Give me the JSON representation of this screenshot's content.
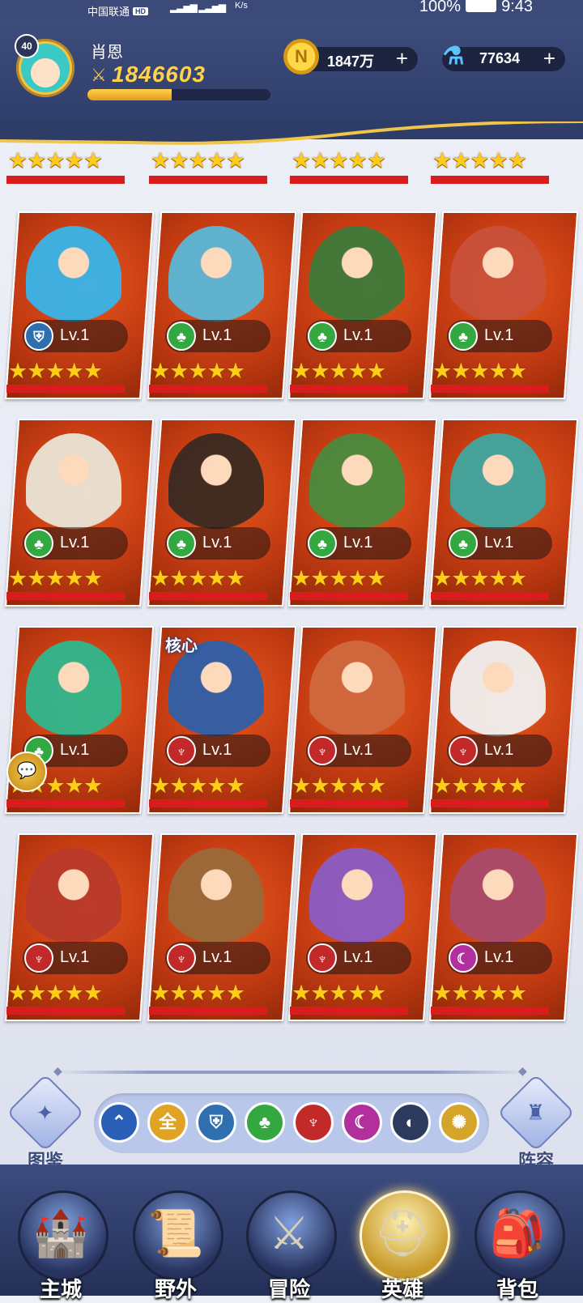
{
  "status_bar": {
    "carrier": "中国联通",
    "hd": "HD",
    "speed": "K/s",
    "battery": "100%",
    "time": "9:43"
  },
  "player": {
    "level": "40",
    "name": "肖恩",
    "power": "1846603",
    "exp_fraction": 0.46
  },
  "resources": {
    "gold": {
      "value": "1847万",
      "icon": "gold-coin-icon",
      "plus": "+"
    },
    "potion": {
      "value": "77634",
      "icon": "potion-icon",
      "plus": "+"
    }
  },
  "heroes": [
    {
      "level": "Lv.1",
      "faction": "fortress",
      "stars": 5,
      "art": "#39b4e8",
      "core": ""
    },
    {
      "level": "Lv.1",
      "faction": "forest",
      "stars": 5,
      "art": "#5ab7d8",
      "core": ""
    },
    {
      "level": "Lv.1",
      "faction": "forest",
      "stars": 5,
      "art": "#3d7a3a",
      "core": ""
    },
    {
      "level": "Lv.1",
      "faction": "forest",
      "stars": 5,
      "art": "#c9503a",
      "core": ""
    },
    {
      "level": "Lv.1",
      "faction": "forest",
      "stars": 5,
      "art": "#e9e4d6",
      "core": ""
    },
    {
      "level": "Lv.1",
      "faction": "forest",
      "stars": 5,
      "art": "#3a2a22",
      "core": ""
    },
    {
      "level": "Lv.1",
      "faction": "forest",
      "stars": 5,
      "art": "#4a8b3e",
      "core": ""
    },
    {
      "level": "Lv.1",
      "faction": "forest",
      "stars": 5,
      "art": "#3fa6a0",
      "core": ""
    },
    {
      "level": "Lv.1",
      "faction": "forest",
      "stars": 5,
      "art": "#2fb88e",
      "core": ""
    },
    {
      "level": "Lv.1",
      "faction": "abyss",
      "stars": 5,
      "art": "#2f5fa8",
      "core": "核心"
    },
    {
      "level": "Lv.1",
      "faction": "abyss",
      "stars": 5,
      "art": "#d0683e",
      "core": ""
    },
    {
      "level": "Lv.1",
      "faction": "abyss",
      "stars": 5,
      "art": "#f0f0f0",
      "core": ""
    },
    {
      "level": "Lv.1",
      "faction": "abyss",
      "stars": 5,
      "art": "#b83a2a",
      "core": ""
    },
    {
      "level": "Lv.1",
      "faction": "abyss",
      "stars": 5,
      "art": "#9a6a3a",
      "core": ""
    },
    {
      "level": "Lv.1",
      "faction": "abyss",
      "stars": 5,
      "art": "#8b5cc4",
      "core": ""
    },
    {
      "level": "Lv.1",
      "faction": "shadow",
      "stars": 5,
      "art": "#a84a6a",
      "core": ""
    }
  ],
  "factions": {
    "fortress": {
      "icon": "helmet-icon",
      "color": "#2f6fb0",
      "glyph": "⛨"
    },
    "forest": {
      "icon": "tree-icon",
      "color": "#34a840",
      "glyph": "♣"
    },
    "abyss": {
      "icon": "demon-icon",
      "color": "#c22a2a",
      "glyph": "♆"
    },
    "shadow": {
      "icon": "moon-horns-icon",
      "color": "#b2309e",
      "glyph": "☾"
    }
  },
  "filters": {
    "left_button": {
      "label": "图鉴",
      "icon": "codex-icon"
    },
    "right_button": {
      "label": "阵容",
      "icon": "formation-icon"
    },
    "items": [
      {
        "name": "collapse",
        "glyph": "⌃",
        "color": "#2a5fb8",
        "icon": "chevron-up-icon"
      },
      {
        "name": "all",
        "glyph": "全",
        "color": "#e0a323",
        "icon": "all-icon"
      },
      {
        "name": "fortress",
        "glyph": "⛨",
        "color": "#2f6fb0",
        "icon": "helmet-icon"
      },
      {
        "name": "forest",
        "glyph": "♣",
        "color": "#34a840",
        "icon": "tree-icon"
      },
      {
        "name": "abyss",
        "glyph": "♆",
        "color": "#c22a2a",
        "icon": "demon-icon"
      },
      {
        "name": "shadow",
        "glyph": "☾",
        "color": "#b2309e",
        "icon": "moon-horns-icon"
      },
      {
        "name": "dark",
        "glyph": "◐",
        "color": "#2c3a5e",
        "icon": "dark-orb-icon"
      },
      {
        "name": "light",
        "glyph": "✺",
        "color": "#d4a52a",
        "icon": "sun-icon"
      }
    ]
  },
  "nav": [
    {
      "label": "主城",
      "icon": "castle-icon",
      "glyph": "🏰",
      "active": false
    },
    {
      "label": "野外",
      "icon": "map-scroll-icon",
      "glyph": "📜",
      "active": false
    },
    {
      "label": "冒险",
      "icon": "sword-shield-icon",
      "glyph": "⚔",
      "active": false
    },
    {
      "label": "英雄",
      "icon": "hero-helmet-icon",
      "glyph": "⛑",
      "active": true
    },
    {
      "label": "背包",
      "icon": "backpack-icon",
      "glyph": "🎒",
      "active": false
    }
  ]
}
